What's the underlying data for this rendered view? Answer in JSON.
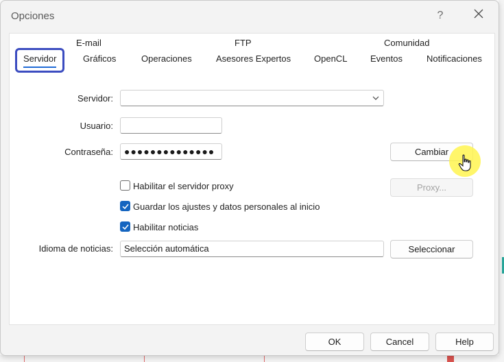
{
  "window": {
    "title": "Opciones",
    "help_label": "?"
  },
  "tabs": {
    "row1": [
      "E-mail",
      "FTP",
      "Comunidad"
    ],
    "row2": [
      "Servidor",
      "Gráficos",
      "Operaciones",
      "Asesores Expertos",
      "OpenCL",
      "Eventos",
      "Notificaciones"
    ],
    "active": "Servidor"
  },
  "form": {
    "server_label": "Servidor:",
    "server_value": "",
    "user_label": "Usuario:",
    "user_value": "",
    "password_label": "Contraseña:",
    "password_value": "●●●●●●●●●●●●●●",
    "change_button": "Cambiar",
    "proxy_checkbox": {
      "label": "Habilitar el servidor proxy",
      "checked": false
    },
    "proxy_button": "Proxy...",
    "save_checkbox": {
      "label": "Guardar los ajustes y datos personales al inicio",
      "checked": true
    },
    "news_checkbox": {
      "label": "Habilitar noticias",
      "checked": true
    },
    "news_language_label": "Idioma de noticias:",
    "news_language_value": "Selección automática",
    "select_button": "Seleccionar"
  },
  "footer": {
    "ok": "OK",
    "cancel": "Cancel",
    "help": "Help"
  },
  "colors": {
    "accent": "#1565c0",
    "active_tab_border": "#3b4cc0",
    "highlight": "#fff550"
  }
}
